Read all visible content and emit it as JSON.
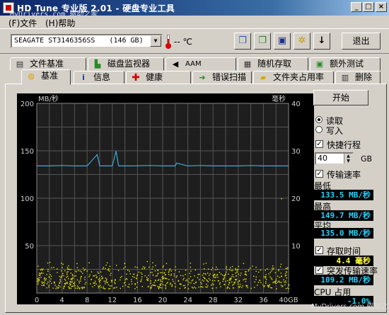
{
  "window": {
    "title": "HD Tune 专业版 2.01 - 硬盘专业工具",
    "watermark": "MyDrivers.com 驱动之家"
  },
  "menu": {
    "file": "(F)文件",
    "help": "(H)帮助"
  },
  "toolbar": {
    "drive": "SEAGATE ST3146356SS",
    "drive_size": "(146 GB)",
    "temperature": "-- ℃",
    "exit_label": "退出",
    "icons": [
      "copy-icon",
      "copy-screenshot-icon",
      "save-icon",
      "options-icon",
      "download-icon"
    ]
  },
  "tabs_row1": [
    "文件基准",
    "磁盘监视器",
    "AAM",
    "随机存取",
    "额外测试"
  ],
  "tabs_row2": [
    "基准",
    "信息",
    "健康",
    "错误扫描",
    "文件夹占用率",
    "删除"
  ],
  "active_tab": "基准",
  "controls": {
    "start_label": "开始",
    "read_label": "读取",
    "write_label": "写入",
    "short_stroke_label": "快捷行程",
    "short_stroke_value": "40",
    "short_stroke_unit": "GB",
    "transfer_rate_label": "传输速率",
    "min_label": "最低",
    "min_value": "133.5 MB/秒",
    "max_label": "最高",
    "max_value": "149.7 MB/秒",
    "avg_label": "平均",
    "avg_value": "135.0 MB/秒",
    "access_time_label": "存取时间",
    "access_time_value": "4.4 毫秒",
    "burst_rate_label": "突发传输速率",
    "burst_rate_value": "109.2 MB/秒",
    "cpu_label": "CPU 占用",
    "cpu_value": "-1.0%"
  },
  "colors": {
    "transfer_line": "#3fa9d6",
    "access_dots": "#e8e800",
    "readout_cyan": "#22d3ff",
    "readout_yellow": "#ffff33"
  },
  "chart_data": {
    "type": "line",
    "left_axis_label": "MB/秒",
    "right_axis_label": "毫秒",
    "x_ticks": [
      "0",
      "4",
      "8",
      "12",
      "16",
      "20",
      "24",
      "28",
      "32",
      "36",
      "40GB"
    ],
    "y_left_ticks": [
      "200",
      "150",
      "100",
      "50"
    ],
    "y_right_ticks": [
      "40",
      "30",
      "20",
      "10"
    ],
    "xlim": [
      0,
      40
    ],
    "ylim_left": [
      0,
      200
    ],
    "ylim_right": [
      0,
      40
    ],
    "grid": true,
    "series": [
      {
        "type": "line",
        "axis": "left",
        "x": [
          0,
          2,
          4,
          6,
          8,
          9.6,
          10,
          10.4,
          12,
          12.6,
          13,
          13.4,
          15,
          18,
          20,
          22,
          22.2,
          24,
          26,
          28,
          30,
          32,
          34,
          36,
          38,
          40
        ],
        "values": [
          134,
          134,
          134.5,
          134,
          134,
          146,
          134,
          134,
          134,
          149.7,
          134,
          134,
          134,
          134.5,
          134,
          134,
          137,
          134,
          134.5,
          134,
          134,
          134,
          134.5,
          134,
          134,
          134
        ]
      },
      {
        "type": "scatter",
        "axis": "right",
        "x_range": [
          0,
          40
        ],
        "y_band": [
          1,
          7
        ],
        "mean": 4.4
      }
    ]
  }
}
